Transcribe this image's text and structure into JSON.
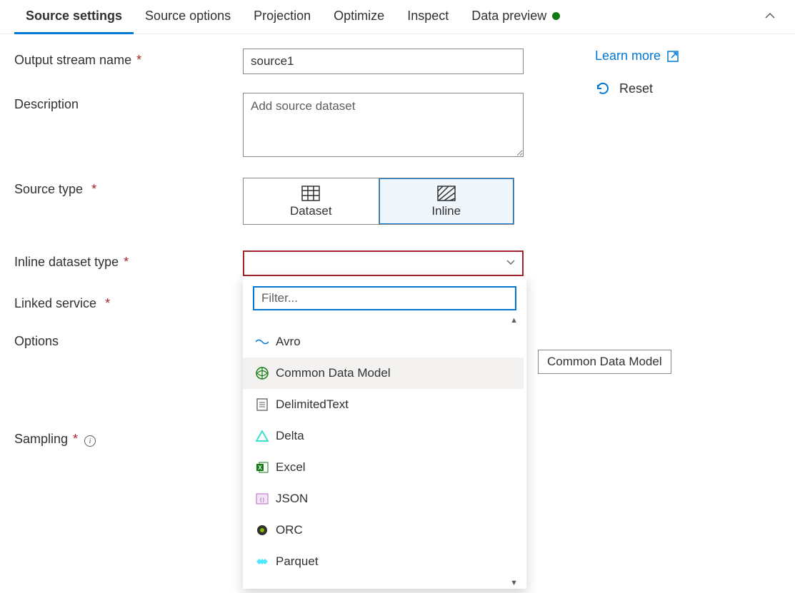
{
  "tabs": {
    "items": [
      {
        "label": "Source settings",
        "active": true
      },
      {
        "label": "Source options",
        "active": false
      },
      {
        "label": "Projection",
        "active": false
      },
      {
        "label": "Optimize",
        "active": false
      },
      {
        "label": "Inspect",
        "active": false
      },
      {
        "label": "Data preview",
        "active": false,
        "status": "green"
      }
    ]
  },
  "form": {
    "output_stream_name": {
      "label": "Output stream name",
      "value": "source1"
    },
    "description": {
      "label": "Description",
      "placeholder": "Add source dataset",
      "value": ""
    },
    "source_type": {
      "label": "Source type",
      "options": [
        {
          "label": "Dataset",
          "icon": "table-icon"
        },
        {
          "label": "Inline",
          "icon": "hatch-icon"
        }
      ],
      "selected": "Inline"
    },
    "inline_dataset_type": {
      "label": "Inline dataset type",
      "value": "",
      "filter_placeholder": "Filter...",
      "options": [
        {
          "label": "Avro",
          "icon": "avro-icon"
        },
        {
          "label": "Common Data Model",
          "icon": "cdm-icon",
          "highlighted": true
        },
        {
          "label": "DelimitedText",
          "icon": "delimited-icon"
        },
        {
          "label": "Delta",
          "icon": "delta-icon"
        },
        {
          "label": "Excel",
          "icon": "excel-icon"
        },
        {
          "label": "JSON",
          "icon": "json-icon"
        },
        {
          "label": "ORC",
          "icon": "orc-icon"
        },
        {
          "label": "Parquet",
          "icon": "parquet-icon"
        }
      ],
      "tooltip": "Common Data Model"
    },
    "linked_service": {
      "label": "Linked service"
    },
    "options_field": {
      "label": "Options"
    },
    "sampling": {
      "label": "Sampling"
    }
  },
  "side": {
    "learn_more": "Learn more",
    "reset": "Reset"
  }
}
